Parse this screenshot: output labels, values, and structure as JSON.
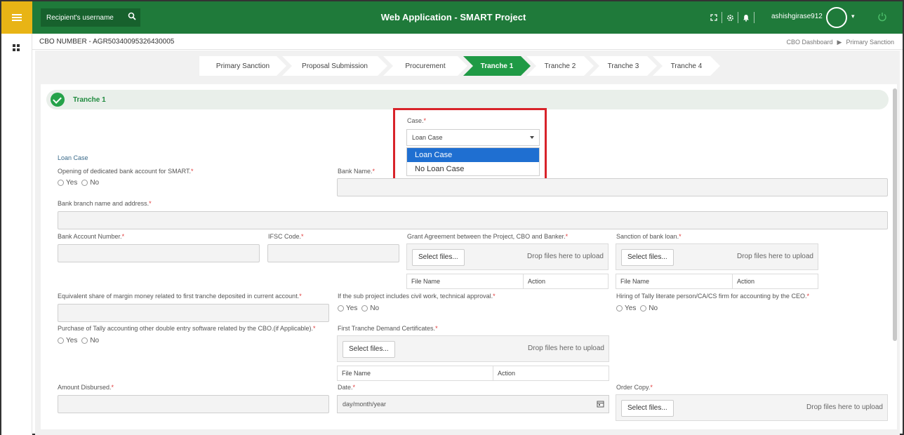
{
  "app": {
    "title": "Web Application - SMART Project",
    "username": "ashishgirase912"
  },
  "search": {
    "placeholder": "Recipient's username"
  },
  "header": {
    "cbo_number": "CBO NUMBER - AGR50340095326430005",
    "breadcrumb": [
      "CBO Dashboard",
      "Primary Sanction"
    ]
  },
  "wizard": {
    "steps": [
      "Primary Sanction",
      "Proposal Submission",
      "Procurement",
      "Tranche 1",
      "Tranche 2",
      "Tranche 3",
      "Tranche 4"
    ],
    "active": "Tranche 1"
  },
  "section": {
    "title": "Tranche 1"
  },
  "case_select": {
    "label": "Case.",
    "value": "Loan Case",
    "options": [
      "Loan Case",
      "No Loan Case"
    ],
    "highlighted": "Loan Case"
  },
  "form": {
    "loan_case_label": "Loan Case",
    "bank_account_opening": "Opening of dedicated bank account for SMART.",
    "bank_name": "Bank Name.",
    "branch": "Bank branch name and address.",
    "account_number": "Bank Account Number.",
    "ifsc": "IFSC Code.",
    "grant_agreement": "Grant Agreement between the Project, CBO and Banker.",
    "sanction_loan": "Sanction of bank loan.",
    "margin_money": "Equivalent share of margin money related to first tranche deposited in current account.",
    "civil_work": "If the sub project includes civil work, technical approval.",
    "tally_hiring": "Hiring of Tally literate person/CA/CS firm for accounting by the CEO.",
    "tally_purchase": "Purchase of Tally accounting other double entry software related by the CBO.(if Applicable).",
    "demand_certs": "First Tranche Demand Certificates.",
    "amount_disbursed": "Amount Disbursed.",
    "date": "Date.",
    "order_copy": "Order Copy.",
    "date_placeholder": "day/month/year"
  },
  "common": {
    "yes": "Yes",
    "no": "No",
    "select_files": "Select files...",
    "drop_files": "Drop files here to upload",
    "file_name": "File Name",
    "action": "Action"
  }
}
